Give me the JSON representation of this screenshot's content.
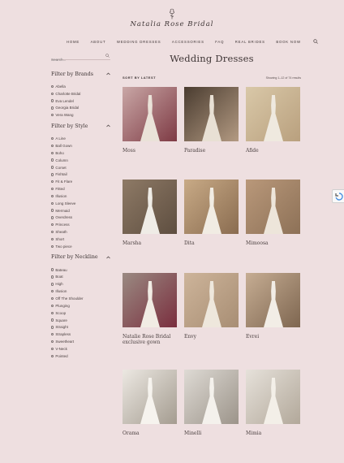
{
  "brand": {
    "logo_text": "Natalia Rose Bridal"
  },
  "nav": {
    "items": [
      "HOME",
      "ABOUT",
      "WEDDING DRESSES",
      "ACCESSORIES",
      "FAQ",
      "REAL BRIDES",
      "BOOK NOW"
    ]
  },
  "sidebar": {
    "search_placeholder": "Search...",
    "filters": [
      {
        "title": "Filter by Brands",
        "options": [
          "Abella",
          "Charlotte Bridal",
          "Eva Lendel",
          "Georgia Bridal",
          "Vera Wang"
        ]
      },
      {
        "title": "Filter by Style",
        "options": [
          "A Line",
          "Ball Gown",
          "Boho",
          "Column",
          "Corset",
          "Fishtail",
          "Fit & Flare",
          "Fitted",
          "Illusion",
          "Long Sleeve",
          "Mermaid",
          "Overdress",
          "Princess",
          "Sheath",
          "Short",
          "Two piece"
        ]
      },
      {
        "title": "Filter by Neckline",
        "options": [
          "Bateau",
          "Boat",
          "High",
          "Illusion",
          "Off The Shoulder",
          "Plunging",
          "Scoop",
          "Square",
          "Straight",
          "Strapless",
          "Sweetheart",
          "V-Neck",
          "Pointed"
        ]
      }
    ]
  },
  "main": {
    "title": "Wedding Dresses",
    "sort_label": "SORT BY LATEST",
    "result_count": "Showing 1–12 of 74 results",
    "products": [
      {
        "name": "Moss"
      },
      {
        "name": "Paradise"
      },
      {
        "name": "Afide"
      },
      {
        "name": "Marsha"
      },
      {
        "name": "Dita"
      },
      {
        "name": "Mimoosa"
      },
      {
        "name": "Natalie Rose Bridal exclusive gown"
      },
      {
        "name": "Envy"
      },
      {
        "name": "Evrei"
      },
      {
        "name": "Orama"
      },
      {
        "name": "Minelli"
      },
      {
        "name": "Mimia"
      }
    ]
  },
  "colors": {
    "background": "#eedfe0",
    "text": "#3e3535"
  }
}
